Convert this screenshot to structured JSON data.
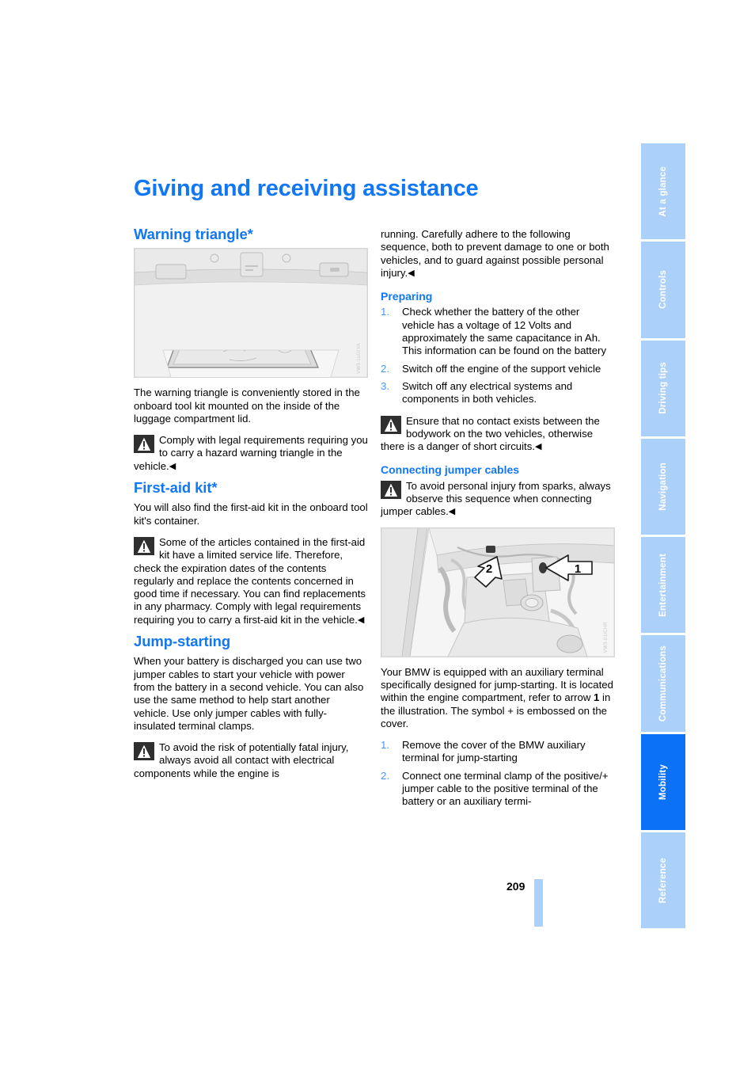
{
  "page": {
    "title": "Giving and receiving assistance",
    "number": "209",
    "accent_blue": "#1177f5",
    "tab_blue": "#abd0fa",
    "tab_active_blue": "#0b72f7"
  },
  "tabs": [
    {
      "label": "At a glance",
      "active": false
    },
    {
      "label": "Controls",
      "active": false
    },
    {
      "label": "Driving tips",
      "active": false
    },
    {
      "label": "Navigation",
      "active": false
    },
    {
      "label": "Entertainment",
      "active": false
    },
    {
      "label": "Communications",
      "active": false
    },
    {
      "label": "Mobility",
      "active": true
    },
    {
      "label": "Reference",
      "active": false
    }
  ],
  "left_column": {
    "warning_triangle": {
      "heading": "Warning triangle*",
      "figure_code": "VW3-1u01VA",
      "body": "The warning triangle is conveniently stored in the onboard tool kit mounted on the inside of the luggage compartment lid.",
      "note": "Comply with legal requirements requiring you to carry a hazard warning triangle in the vehicle."
    },
    "first_aid_kit": {
      "heading": "First-aid kit*",
      "body": "You will also find the first-aid kit in the onboard tool kit's container.",
      "note": "Some of the articles contained in the first-aid kit have a limited service life. Therefore, check the expiration dates of the contents regularly and replace the contents concerned in good time if necessary. You can find replacements in any pharmacy. Comply with legal requirements requiring you to carry a first-aid kit in the vehicle."
    },
    "jump_starting": {
      "heading": "Jump-starting",
      "body": "When your battery is discharged you can use two jumper cables to start your vehicle with power from the battery in a second vehicle. You can also use the same method to help start another vehicle. Use only jumper cables with fully-insulated terminal clamps.",
      "note_part1": "To avoid the risk of potentially fatal injury, always avoid all contact with electrical components while the engine is"
    }
  },
  "right_column": {
    "note_continuation": "running. Carefully adhere to the following sequence, both to prevent damage to one or both vehicles, and to guard against possible personal injury.",
    "preparing": {
      "heading": "Preparing",
      "steps": [
        {
          "num": "1.",
          "text": "Check whether the battery of the other vehicle has a voltage of 12 Volts and approximately the same capacitance in Ah. This information can be found on the battery"
        },
        {
          "num": "2.",
          "text": "Switch off the engine of the support vehicle"
        },
        {
          "num": "3.",
          "text": "Switch off any electrical systems and components in both vehicles."
        }
      ],
      "note": "Ensure that no contact exists between the bodywork on the two vehicles, otherwise there is a danger of short circuits."
    },
    "connecting_jumper_cables": {
      "heading": "Connecting jumper cables",
      "note": "To avoid personal injury from sparks, always observe this sequence when connecting jumper cables.",
      "figure_code": "VW3-01ICHR",
      "figure_arrow_1": "1",
      "figure_arrow_2": "2",
      "body_a": "Your BMW is equipped with an auxiliary terminal specifically designed for jump-starting. It is located within the engine compartment, refer to arrow ",
      "body_bold": "1",
      "body_b": " in the illustration. The symbol + is embossed on the cover.",
      "steps": [
        {
          "num": "1.",
          "text": "Remove the cover of the BMW auxiliary terminal for jump-starting"
        },
        {
          "num": "2.",
          "text": "Connect one terminal clamp of the positive/+ jumper cable to the positive terminal of the battery or an auxiliary termi-"
        }
      ]
    }
  },
  "icons": {
    "warning_triangle_icon": "warning-triangle-icon"
  }
}
